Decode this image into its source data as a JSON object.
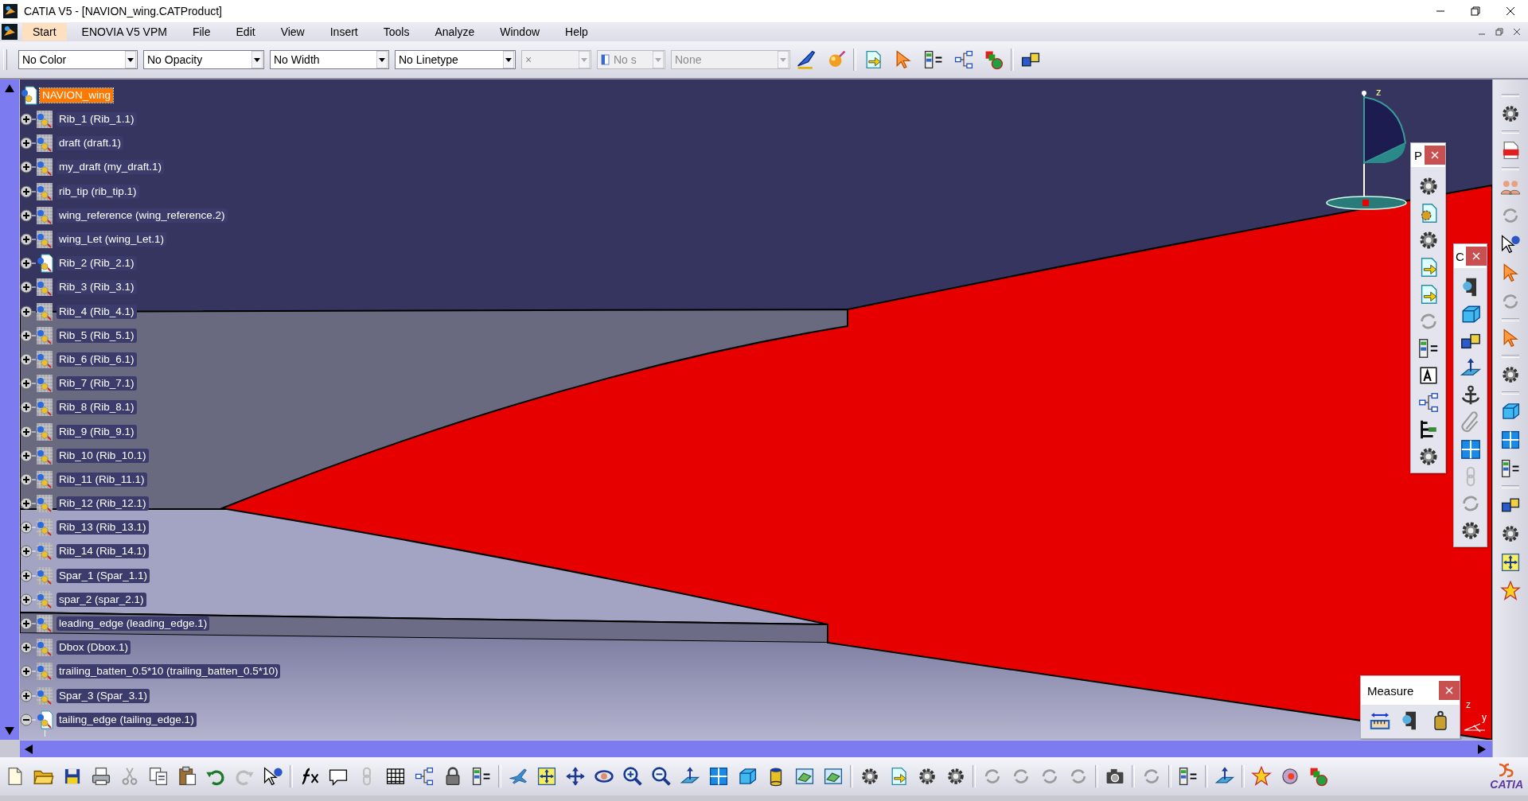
{
  "window": {
    "title": "CATIA V5 - [NAVION_wing.CATProduct]"
  },
  "menu_bar": {
    "items": [
      {
        "label": "Start",
        "selected": true
      },
      {
        "label": "ENOVIA V5 VPM",
        "selected": false
      },
      {
        "label": "File",
        "selected": false
      },
      {
        "label": "Edit",
        "selected": false
      },
      {
        "label": "View",
        "selected": false
      },
      {
        "label": "Insert",
        "selected": false
      },
      {
        "label": "Tools",
        "selected": false
      },
      {
        "label": "Analyze",
        "selected": false
      },
      {
        "label": "Window",
        "selected": false
      },
      {
        "label": "Help",
        "selected": false
      }
    ]
  },
  "format_toolbar": {
    "dropdowns": [
      {
        "value": "No Color",
        "disabled": false,
        "kind": "text"
      },
      {
        "value": "No Opacity",
        "disabled": false,
        "kind": "text"
      },
      {
        "value": "No Width",
        "disabled": false,
        "kind": "text"
      },
      {
        "value": "No Linetype",
        "disabled": false,
        "kind": "text"
      },
      {
        "value": "×",
        "disabled": true,
        "kind": "text"
      },
      {
        "value": "No s",
        "disabled": true,
        "kind": "layer"
      },
      {
        "value": "None",
        "disabled": true,
        "kind": "text"
      }
    ]
  },
  "tree": {
    "root": {
      "label": "NAVION_wing",
      "selected": true,
      "children": [
        {
          "label": "Rib_1 (Rib_1.1)",
          "kind": "component",
          "expanded": false,
          "selected": false
        },
        {
          "label": "draft (draft.1)",
          "kind": "component",
          "expanded": false,
          "selected": false
        },
        {
          "label": "my_draft (my_draft.1)",
          "kind": "component",
          "expanded": false,
          "selected": false
        },
        {
          "label": "rib_tip (rib_tip.1)",
          "kind": "component",
          "expanded": false,
          "selected": false
        },
        {
          "label": "wing_reference (wing_reference.2)",
          "kind": "component",
          "expanded": false,
          "selected": false
        },
        {
          "label": "wing_Let (wing_Let.1)",
          "kind": "component",
          "expanded": false,
          "selected": false
        },
        {
          "label": "Rib_2 (Rib_2.1)",
          "kind": "product",
          "expanded": false,
          "selected": false
        },
        {
          "label": "Rib_3 (Rib_3.1)",
          "kind": "component",
          "expanded": false,
          "selected": false
        },
        {
          "label": "Rib_4 (Rib_4.1)",
          "kind": "component",
          "expanded": false,
          "selected": false
        },
        {
          "label": "Rib_5 (Rib_5.1)",
          "kind": "component",
          "expanded": false,
          "selected": false
        },
        {
          "label": "Rib_6 (Rib_6.1)",
          "kind": "component",
          "expanded": false,
          "selected": false
        },
        {
          "label": "Rib_7 (Rib_7.1)",
          "kind": "component",
          "expanded": false,
          "selected": false
        },
        {
          "label": "Rib_8 (Rib_8.1)",
          "kind": "component",
          "expanded": false,
          "selected": false
        },
        {
          "label": "Rib_9 (Rib_9.1)",
          "kind": "component",
          "expanded": false,
          "selected": false
        },
        {
          "label": "Rib_10 (Rib_10.1)",
          "kind": "component",
          "expanded": false,
          "selected": false
        },
        {
          "label": "Rib_11 (Rib_11.1)",
          "kind": "component",
          "expanded": false,
          "selected": false
        },
        {
          "label": "Rib_12 (Rib_12.1)",
          "kind": "component",
          "expanded": false,
          "selected": false
        },
        {
          "label": "Rib_13 (Rib_13.1)",
          "kind": "component",
          "expanded": false,
          "selected": false
        },
        {
          "label": "Rib_14 (Rib_14.1)",
          "kind": "component",
          "expanded": false,
          "selected": false
        },
        {
          "label": "Spar_1 (Spar_1.1)",
          "kind": "component",
          "expanded": false,
          "selected": false
        },
        {
          "label": "spar_2 (spar_2.1)",
          "kind": "component",
          "expanded": false,
          "selected": false
        },
        {
          "label": "leading_edge (leading_edge.1)",
          "kind": "component",
          "expanded": false,
          "selected": false
        },
        {
          "label": "Dbox (Dbox.1)",
          "kind": "component",
          "expanded": false,
          "selected": false
        },
        {
          "label": "trailing_batten_0.5*10 (trailing_batten_0.5*10)",
          "kind": "component",
          "expanded": false,
          "selected": false
        },
        {
          "label": "Spar_3 (Spar_3.1)",
          "kind": "component",
          "expanded": false,
          "selected": false
        },
        {
          "label": "tailing_edge (tailing_edge.1)",
          "kind": "product",
          "expanded": true,
          "selected": false
        }
      ]
    }
  },
  "compass": {
    "axis_label": "z"
  },
  "axis_triad": {
    "labels": [
      "z",
      "y"
    ]
  },
  "panels": [
    {
      "title": "P"
    },
    {
      "title": "C"
    },
    {
      "title": "Measure"
    }
  ],
  "logo": {
    "text": "CATIA"
  }
}
